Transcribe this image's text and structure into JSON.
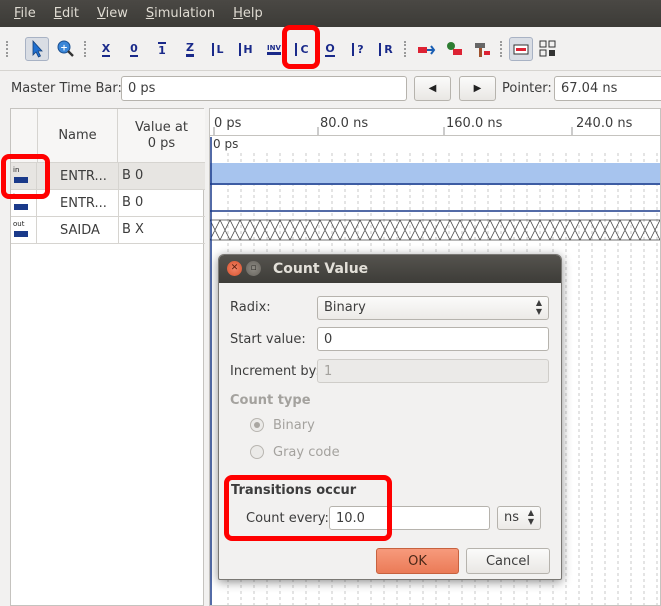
{
  "menubar": {
    "items": [
      {
        "label": "File",
        "mnemonic": "F",
        "rest": "ile"
      },
      {
        "label": "Edit",
        "mnemonic": "E",
        "rest": "dit"
      },
      {
        "label": "View",
        "mnemonic": "V",
        "rest": "iew"
      },
      {
        "label": "Simulation",
        "mnemonic": "S",
        "rest": "imulation"
      },
      {
        "label": "Help",
        "mnemonic": "H",
        "rest": "elp"
      }
    ]
  },
  "toolbar": {
    "tools": [
      {
        "name": "selection-tool-icon",
        "text": ""
      },
      {
        "name": "zoom-tool-icon",
        "text": ""
      },
      {
        "name": "forcing-unknown-icon",
        "text": "X"
      },
      {
        "name": "forcing-low-icon",
        "text": "0"
      },
      {
        "name": "forcing-high-icon",
        "text": "1"
      },
      {
        "name": "high-impedance-icon",
        "text": "Z"
      },
      {
        "name": "weak-low-icon",
        "text": "L"
      },
      {
        "name": "weak-high-icon",
        "text": "H"
      },
      {
        "name": "invert-icon",
        "text": "INV"
      },
      {
        "name": "count-value-icon",
        "text": "C"
      },
      {
        "name": "clock-icon",
        "text": "O"
      },
      {
        "name": "arbitrary-value-icon",
        "text": "?"
      },
      {
        "name": "random-value-icon",
        "text": "R"
      }
    ],
    "accent": "#1a2a8a",
    "highlight_color": "#ff0000"
  },
  "timebar": {
    "master_label": "Master Time Bar:",
    "master_value": "0 ps",
    "prev_glyph": "◀",
    "next_glyph": "▶",
    "pointer_label": "Pointer:",
    "pointer_value": "67.04 ns"
  },
  "signals": {
    "col_name": "Name",
    "col_value": "Value at\n0 ps",
    "rows": [
      {
        "type": "in",
        "name": "ENTR...",
        "value": "B 0",
        "selected": true
      },
      {
        "type": "in",
        "name": "ENTR...",
        "value": "B 0",
        "selected": false
      },
      {
        "type": "out",
        "name": "SAIDA",
        "value": "B X",
        "selected": false
      }
    ]
  },
  "waveform": {
    "ticks": [
      "0 ps",
      "80.0 ns",
      "160.0 ns",
      "240.0 ns"
    ],
    "cursor_label": "0 ps",
    "selected_fill": "#a7c4ee"
  },
  "dialog": {
    "title": "Count Value",
    "radix_label": "Radix:",
    "radix_value": "Binary",
    "start_label": "Start value:",
    "start_value": "0",
    "increment_label": "Increment by:",
    "increment_value": "1",
    "count_type_label": "Count type",
    "count_type_options": [
      "Binary",
      "Gray code"
    ],
    "transitions_label": "Transitions occur",
    "count_every_label": "Count every:",
    "count_every_value": "10.0",
    "unit_value": "ns",
    "ok_label": "OK",
    "cancel_label": "Cancel"
  }
}
